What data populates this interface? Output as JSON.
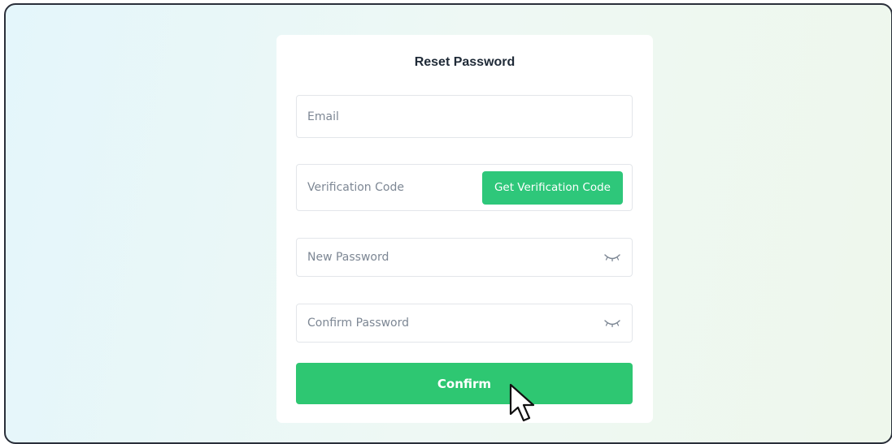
{
  "form": {
    "title": "Reset Password",
    "email": {
      "placeholder": "Email",
      "value": ""
    },
    "verification_code": {
      "placeholder": "Verification Code",
      "value": "",
      "button_label": "Get Verification Code"
    },
    "new_password": {
      "placeholder": "New Password",
      "value": "",
      "toggle_icon": "eye-closed-icon"
    },
    "confirm_password": {
      "placeholder": "Confirm Password",
      "value": "",
      "toggle_icon": "eye-closed-icon"
    },
    "confirm_label": "Confirm"
  },
  "colors": {
    "accent": "#2ec772",
    "title_text": "#1f2a37",
    "placeholder_text": "#7d8794",
    "field_border": "#e3e6ea"
  }
}
